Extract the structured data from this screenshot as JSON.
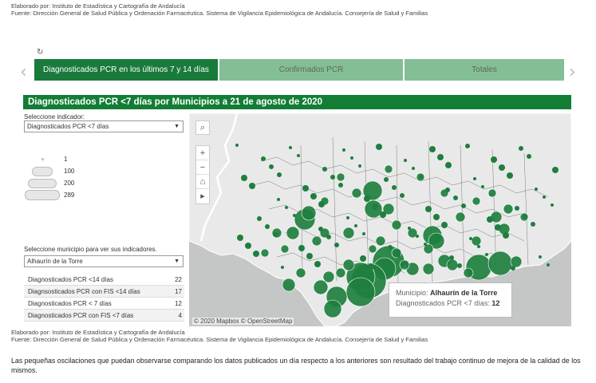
{
  "credits": {
    "line1": "Elaborado por: Instituto de Estadística y Cartografía de Andalucía",
    "line2": "Fuente: Dirección General de Salud Pública y Ordenación Farmacéutica. Sistema de Vigilancia Epidemiológica de Andalucía. Consejería de Salud y Familias"
  },
  "refresh_icon": "refresh-icon",
  "tabs": [
    {
      "label": "Diagnosticados PCR en los últimos 7 y 14 días"
    },
    {
      "label": "Confirmados PCR"
    },
    {
      "label": "Totales"
    }
  ],
  "title": "Diagnosticados PCR <7 días por Municipios a 21 de agosto de 2020",
  "indicator": {
    "label": "Seleccione indicador:",
    "selected": "Diagnosticados PCR <7 días"
  },
  "size_legend": [
    "1",
    "100",
    "200",
    "289"
  ],
  "municipio": {
    "label": "Seleccione municipio para ver sus indicadores.",
    "selected": "Alhaurín de la Torre"
  },
  "indicators": [
    {
      "name": "Diagnosticados PCR <14 días",
      "value": "22"
    },
    {
      "name": "Diagnsosticados PCR con FIS <14 días",
      "value": "17"
    },
    {
      "name": "Diagnosticados PCR < 7 días",
      "value": "12"
    },
    {
      "name": "Diagnosticados PCR con FIS <7 días",
      "value": "4"
    }
  ],
  "map": {
    "attribution": "© 2020 Mapbox © OpenStreetMap",
    "tooltip_label": "Municipio:",
    "tooltip_name": "Alhaurín de la Torre",
    "tooltip_ind": "Diagnosticados PCR <7 días:",
    "tooltip_value": "12",
    "marker_color": "#1e7f3e",
    "land_color": "#e9e9e9",
    "sea_color": "#c5c7c6"
  },
  "footer_note": "Las pequeñas oscilaciones que puedan observarse comparando los datos publicados un día respecto a los anteriores son resultado del trabajo continuo de mejora de la calidad de los mismos."
}
